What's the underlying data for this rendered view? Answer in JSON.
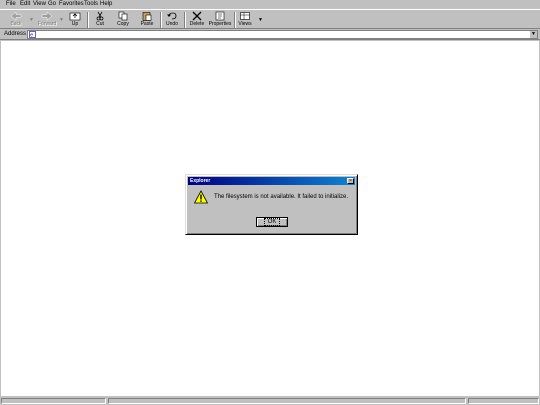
{
  "menubar": {
    "items": [
      {
        "label": "File"
      },
      {
        "label": "Edit"
      },
      {
        "label": "View"
      },
      {
        "label": "Go"
      },
      {
        "label": "Favorites"
      },
      {
        "label": "Tools"
      },
      {
        "label": "Help"
      }
    ]
  },
  "toolbar": {
    "buttons": [
      {
        "label": "Back",
        "icon": "back-arrow-icon",
        "enabled": false
      },
      {
        "label": "Forward",
        "icon": "forward-arrow-icon",
        "enabled": false
      },
      {
        "label": "Up",
        "icon": "up-folder-icon",
        "enabled": true
      },
      {
        "label": "Cut",
        "icon": "scissors-icon",
        "enabled": true
      },
      {
        "label": "Copy",
        "icon": "copy-icon",
        "enabled": true
      },
      {
        "label": "Paste",
        "icon": "paste-icon",
        "enabled": true
      },
      {
        "label": "Undo",
        "icon": "undo-icon",
        "enabled": true
      },
      {
        "label": "Delete",
        "icon": "delete-x-icon",
        "enabled": true
      },
      {
        "label": "Properties",
        "icon": "properties-icon",
        "enabled": true
      },
      {
        "label": "Views",
        "icon": "views-icon",
        "enabled": true
      }
    ]
  },
  "addressbar": {
    "label": "Address",
    "value": ""
  },
  "dialog": {
    "title": "Explorer",
    "message": "The filesystem is not available. It failed to initialize.",
    "ok_label": "OK",
    "icon": "warning-icon"
  },
  "colors": {
    "face": "#c0c0c0",
    "title_bar": "#000080",
    "content_bg": "#ffffff"
  }
}
